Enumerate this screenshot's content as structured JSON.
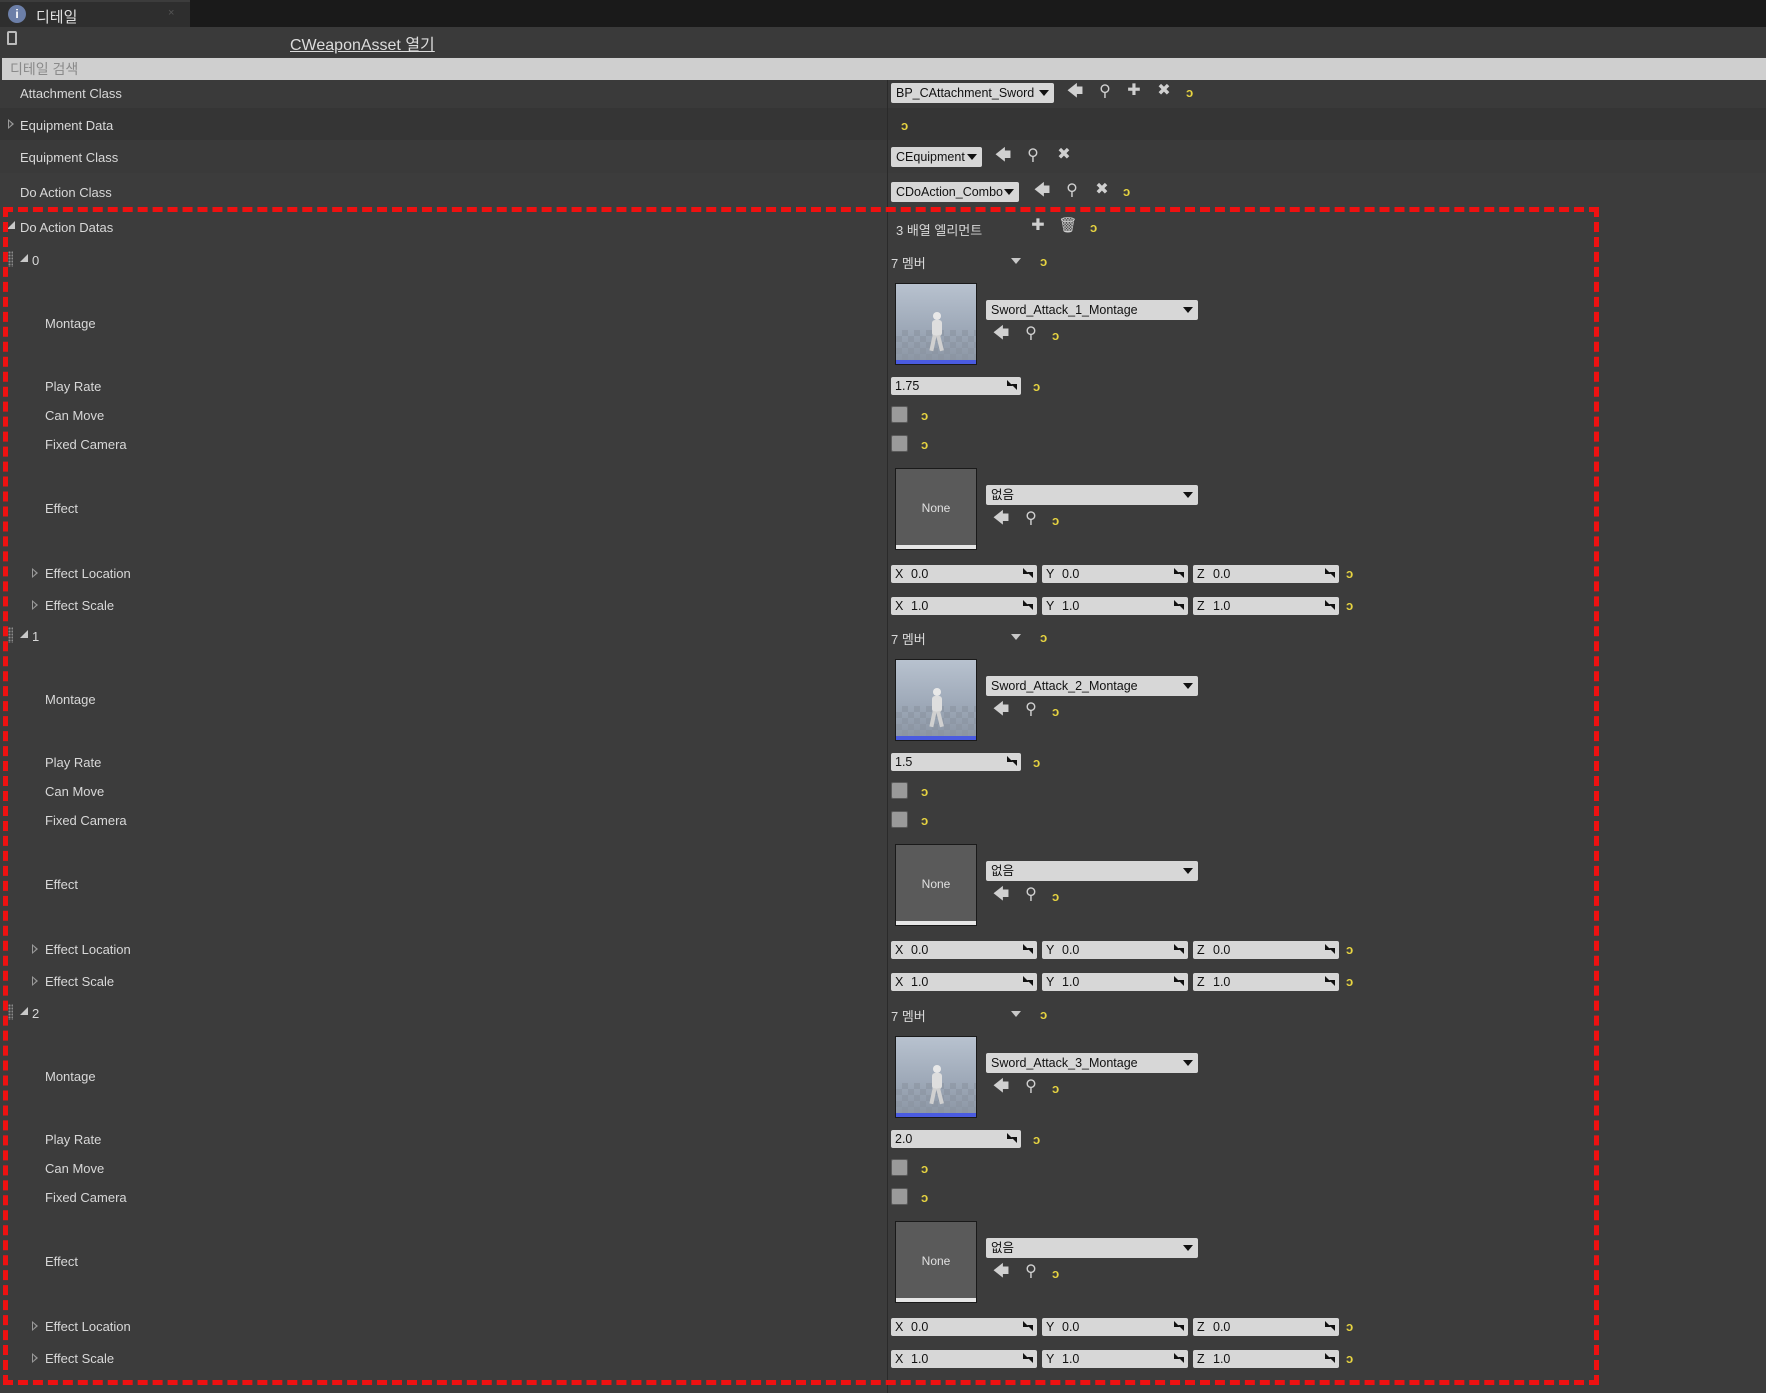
{
  "tab": {
    "icon": "i",
    "title": "디테일",
    "close": "×"
  },
  "open_link": "CWeaponAsset 열기",
  "search": {
    "placeholder": "디테일 검색",
    "value": ""
  },
  "top_props": {
    "attachment_class": {
      "label": "Attachment Class",
      "value": "BP_CAttachment_Sword"
    },
    "equipment_data": {
      "label": "Equipment Data"
    },
    "equipment_class": {
      "label": "Equipment Class",
      "value": "CEquipment"
    },
    "do_action_class": {
      "label": "Do Action Class",
      "value": "CDoAction_Combo"
    }
  },
  "do_action_datas": {
    "label": "Do Action Datas",
    "count_text": "3 배열 엘리먼트",
    "elements": [
      {
        "index": "0",
        "members": "7 멤버",
        "montage_label": "Montage",
        "montage": "Sword_Attack_1_Montage",
        "play_rate_label": "Play Rate",
        "play_rate": "1.75",
        "can_move_label": "Can Move",
        "fixed_camera_label": "Fixed Camera",
        "effect_label": "Effect",
        "effect": "없음",
        "effect_thumb": "None",
        "effect_location_label": "Effect Location",
        "effect_location": [
          "0.0",
          "0.0",
          "0.0"
        ],
        "effect_scale_label": "Effect Scale",
        "effect_scale": [
          "1.0",
          "1.0",
          "1.0"
        ]
      },
      {
        "index": "1",
        "members": "7 멤버",
        "montage_label": "Montage",
        "montage": "Sword_Attack_2_Montage",
        "play_rate_label": "Play Rate",
        "play_rate": "1.5",
        "can_move_label": "Can Move",
        "fixed_camera_label": "Fixed Camera",
        "effect_label": "Effect",
        "effect": "없음",
        "effect_thumb": "None",
        "effect_location_label": "Effect Location",
        "effect_location": [
          "0.0",
          "0.0",
          "0.0"
        ],
        "effect_scale_label": "Effect Scale",
        "effect_scale": [
          "1.0",
          "1.0",
          "1.0"
        ]
      },
      {
        "index": "2",
        "members": "7 멤버",
        "montage_label": "Montage",
        "montage": "Sword_Attack_3_Montage",
        "play_rate_label": "Play Rate",
        "play_rate": "2.0",
        "can_move_label": "Can Move",
        "fixed_camera_label": "Fixed Camera",
        "effect_label": "Effect",
        "effect": "없음",
        "effect_thumb": "None",
        "effect_location_label": "Effect Location",
        "effect_location": [
          "0.0",
          "0.0",
          "0.0"
        ],
        "effect_scale_label": "Effect Scale",
        "effect_scale": [
          "1.0",
          "1.0",
          "1.0"
        ]
      }
    ]
  },
  "axis_labels": [
    "X",
    "Y",
    "Z"
  ],
  "glyphs": {
    "reset": "ↄ",
    "back": "🡄",
    "browse": "⚲",
    "add": "✚",
    "clear": "✖",
    "delete": "🗑"
  },
  "colors": {
    "reset_arrow": "#e6d341",
    "highlight_border": "#ee1111",
    "field_bg": "#d7d7d7",
    "panel_bg": "#3c3c3c"
  }
}
